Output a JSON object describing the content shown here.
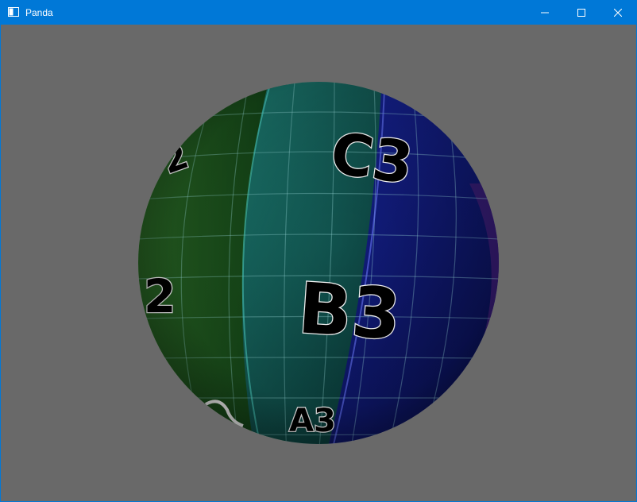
{
  "window": {
    "title": "Panda",
    "titlebar_color": "#0078d7",
    "background_color": "#696969",
    "controls": {
      "minimize_icon": "minimize-icon",
      "maximize_icon": "maximize-icon",
      "close_icon": "close-icon"
    }
  },
  "scene": {
    "object": "textured-sphere",
    "labels": {
      "c3": "C3",
      "b3": "B3",
      "a3": "A3",
      "left_top": "2",
      "left_mid": "2"
    },
    "colors": {
      "green": "#1f5a1e",
      "teal": "#0f5a55",
      "blue": "#0a1770",
      "purple": "#3a1a6a"
    }
  }
}
